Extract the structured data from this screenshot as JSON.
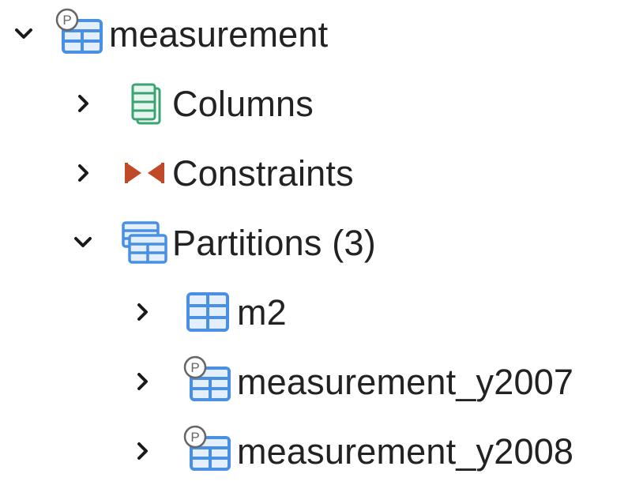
{
  "tree": {
    "root": {
      "label": "measurement",
      "icon": "partitioned-table-icon",
      "expanded": true
    },
    "children": [
      {
        "label": "Columns",
        "icon": "columns-icon",
        "expanded": false
      },
      {
        "label": "Constraints",
        "icon": "constraints-icon",
        "expanded": false
      },
      {
        "label": "Partitions (3)",
        "icon": "partitions-icon",
        "expanded": true
      }
    ],
    "partitions": [
      {
        "label": "m2",
        "icon": "table-icon",
        "expanded": false
      },
      {
        "label": "measurement_y2007",
        "icon": "partitioned-table-icon",
        "expanded": false
      },
      {
        "label": "measurement_y2008",
        "icon": "partitioned-table-icon",
        "expanded": false
      }
    ]
  },
  "colors": {
    "table_blue": "#4a90e2",
    "table_fill": "#e3effc",
    "columns_green": "#3aa372",
    "constraint_red": "#c0492a",
    "chevron": "#1a1a1a",
    "badge_gray": "#666666"
  }
}
